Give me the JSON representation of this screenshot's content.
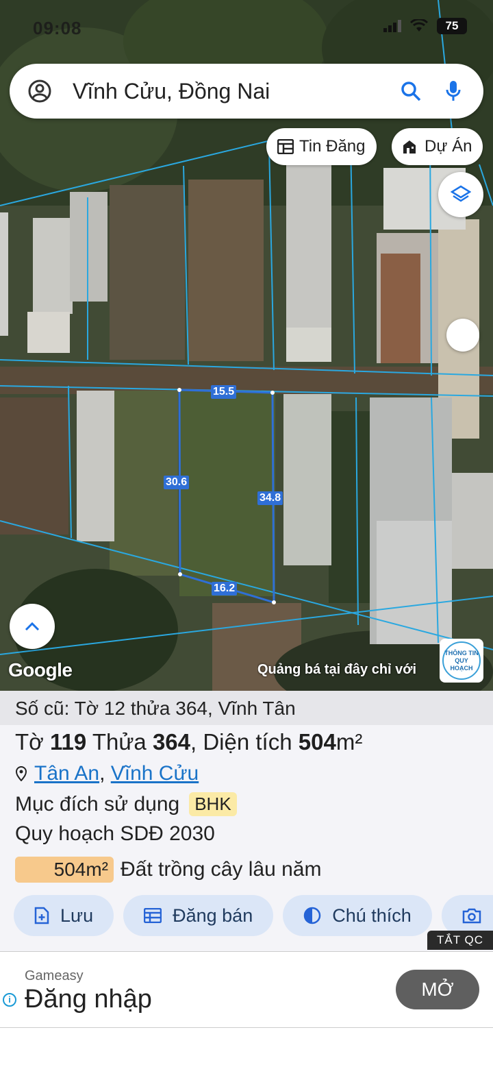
{
  "status_bar": {
    "time": "09:08",
    "battery": "75"
  },
  "search": {
    "query": "Vĩnh Cửu, Đồng Nai"
  },
  "chips": {
    "listings": "Tin Đăng",
    "projects": "Dự Án"
  },
  "map": {
    "measurements": {
      "top": "15.5",
      "left": "30.6",
      "right": "34.8",
      "bottom": "16.2"
    },
    "google_logo": "Google",
    "ad_text": "Quảng bá tại đây chỉ với",
    "badge_text": "THÔNG TIN QUY HOẠCH"
  },
  "parcel": {
    "old_number": "Số cũ: Tờ 12 thửa 364, Vĩnh Tân",
    "sheet_label": "Tờ",
    "sheet_no": "119",
    "plot_label": "Thửa",
    "plot_no": "364",
    "area_label": ", Diện tích",
    "area_value": "504",
    "area_unit": "m²",
    "ward": "Tân An",
    "district": "Vĩnh Cửu",
    "purpose_label": "Mục đích sử dụng",
    "purpose_code": "BHK",
    "plan_label": "Quy hoạch SDĐ 2030",
    "landuse_area": "504m²",
    "landuse_name": "Đất trồng cây lâu năm"
  },
  "actions": {
    "save": "Lưu",
    "post_sale": "Đăng bán",
    "legend": "Chú thích",
    "camera": "C"
  },
  "ad_toggle": "TẮT QC",
  "ad": {
    "sponsor": "Gameasy",
    "title": "Đăng nhập",
    "open": "MỞ"
  },
  "colors": {
    "accent": "#1a73c8",
    "boundary": "#2aa8e0",
    "measure": "#2f6fd6",
    "landuse": "#f7c98c",
    "action_bg": "#dbe6f7"
  }
}
